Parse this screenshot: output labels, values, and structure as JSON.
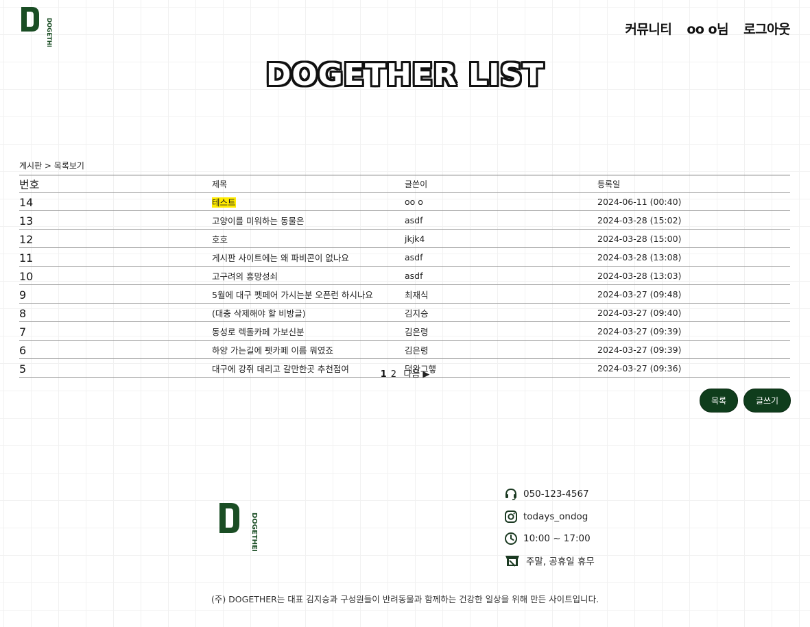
{
  "header": {
    "logo_text": "DOGETHER",
    "nav": {
      "community": "커뮤니티",
      "user": "oo o님",
      "logout": "로그아웃"
    }
  },
  "page_title": "DOGETHER LIST",
  "breadcrumb": "게시판 > 목록보기",
  "table": {
    "headers": {
      "no": "번호",
      "title": "제목",
      "writer": "글쓴이",
      "date": "등록일"
    },
    "rows": [
      {
        "no": "14",
        "title": "테스트",
        "writer": "oo o",
        "date": "2024-06-11 (00:40)",
        "highlight": true
      },
      {
        "no": "13",
        "title": "고양이를 미워하는 동물은",
        "writer": "asdf",
        "date": "2024-03-28 (15:02)"
      },
      {
        "no": "12",
        "title": "호호",
        "writer": "jkjk4",
        "date": "2024-03-28 (15:00)"
      },
      {
        "no": "11",
        "title": "게시판 사이트에는 왜 파비콘이 없나요",
        "writer": "asdf",
        "date": "2024-03-28 (13:08)"
      },
      {
        "no": "10",
        "title": "고구려의 흥망성쇠",
        "writer": "asdf",
        "date": "2024-03-28 (13:03)"
      },
      {
        "no": "9",
        "title": "5월에 대구 펫페어 가시는분 오픈런 하시나요",
        "writer": "최재식",
        "date": "2024-03-27 (09:48)"
      },
      {
        "no": "8",
        "title": "(대충 삭제해야 할 비방글)",
        "writer": "김지승",
        "date": "2024-03-27 (09:40)"
      },
      {
        "no": "7",
        "title": "동성로 렉돌카페 가보신분",
        "writer": "김은령",
        "date": "2024-03-27 (09:39)"
      },
      {
        "no": "6",
        "title": "하양 가는길에 펫카페 이름 뭐였죠",
        "writer": "김은령",
        "date": "2024-03-27 (09:39)"
      },
      {
        "no": "5",
        "title": "대구에 강쥐 데리고 갈만한곳 추천점여",
        "writer": "덕완그햏",
        "date": "2024-03-27 (09:36)"
      }
    ]
  },
  "pagination": {
    "pages": [
      "1",
      "2"
    ],
    "current": "1",
    "next": "다음 ▶"
  },
  "buttons": {
    "list": "목록",
    "write": "글쓰기"
  },
  "footer": {
    "logo_text": "DOGETHER",
    "phone": "050-123-4567",
    "instagram": "todays_ondog",
    "hours": "10:00 ~ 17:00",
    "closed": "주말, 공휴일 휴무",
    "description": "(주) DOGETHER는 대표 김지승과 구성원들이 반려동물과 함께하는 건강한 일상을 위해 만든 사이트입니다."
  },
  "colors": {
    "brand_green": "#0f3d1c",
    "highlight": "#ffeb00"
  }
}
